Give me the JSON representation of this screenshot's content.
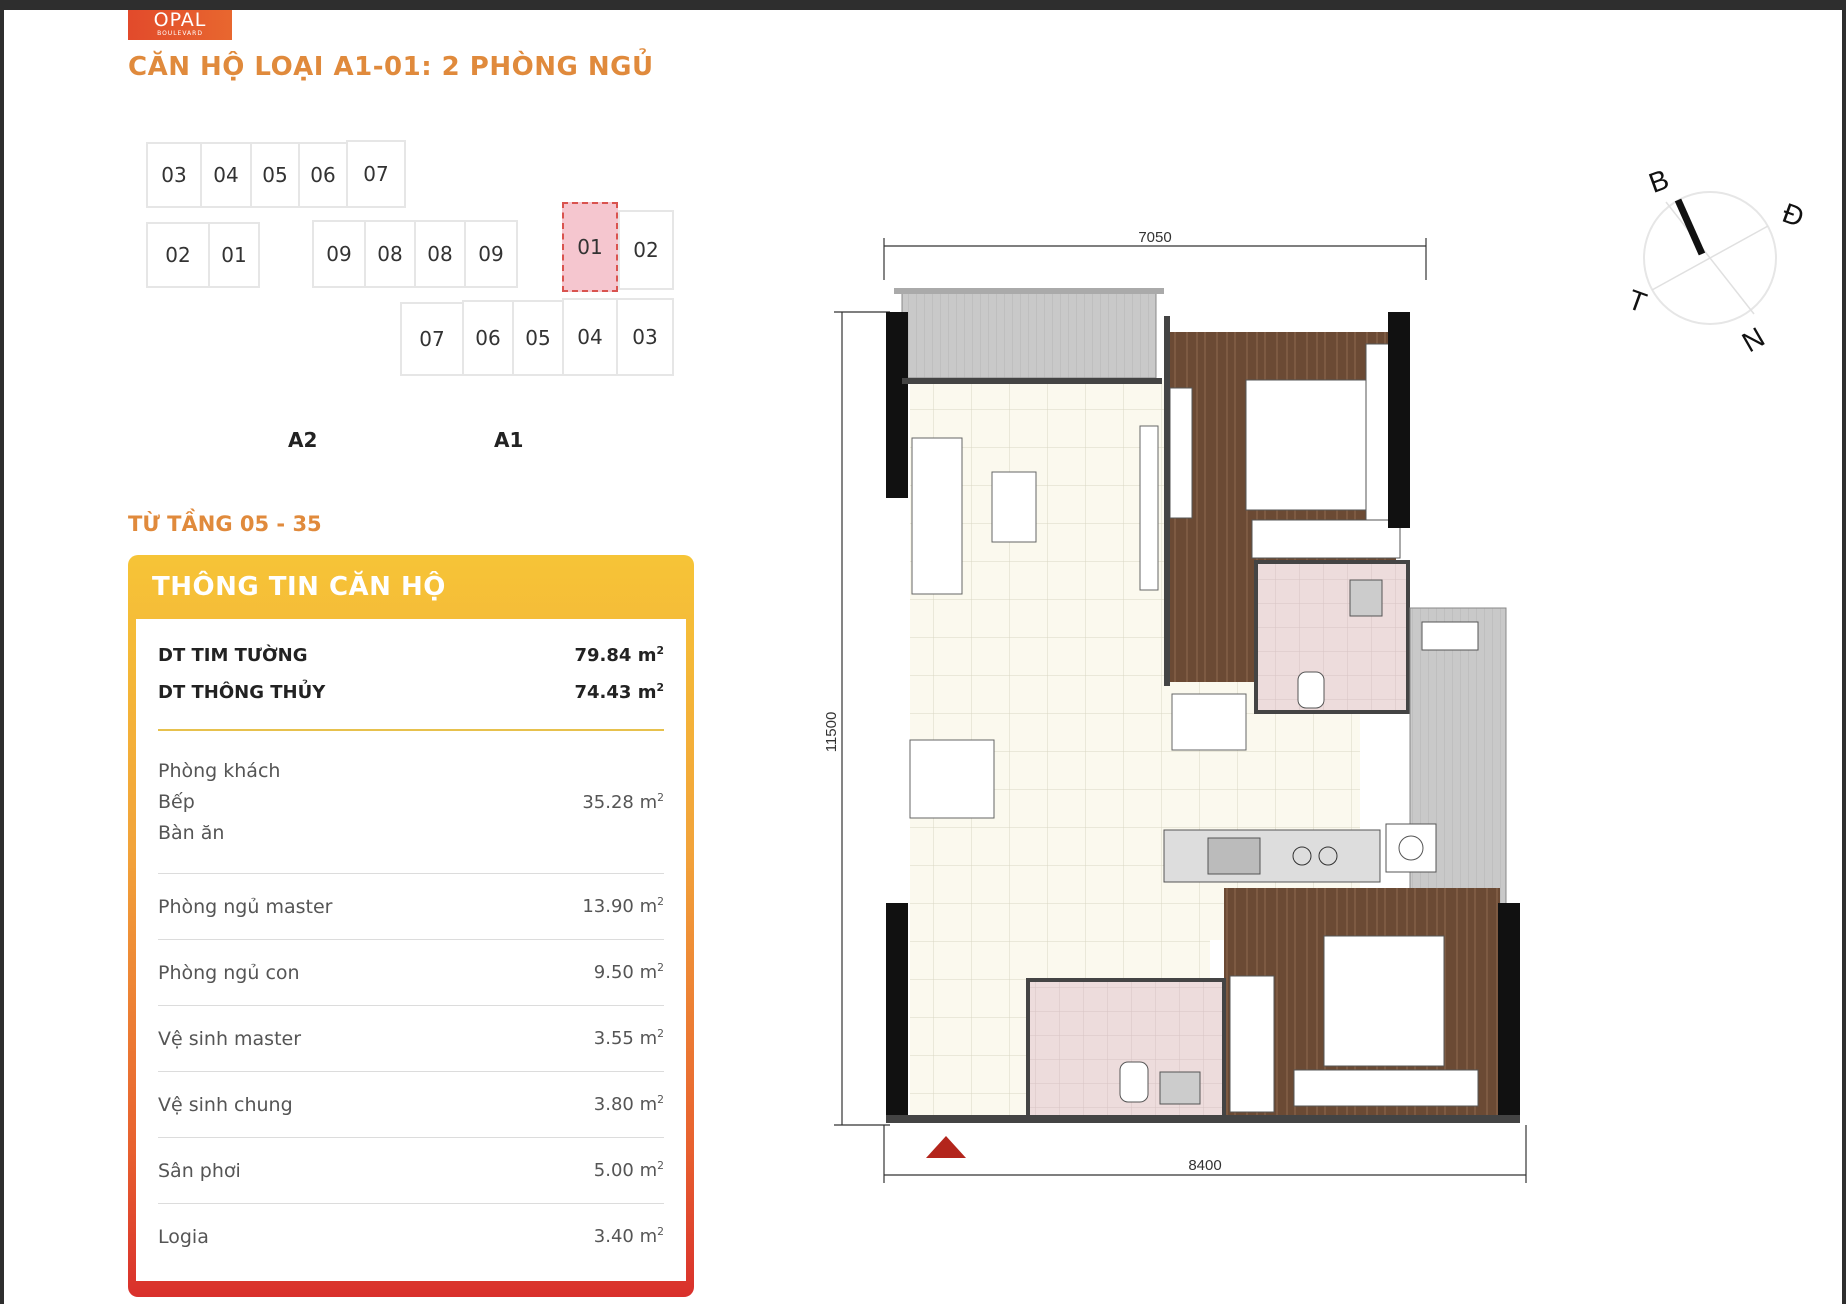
{
  "brand": {
    "logo_line1": "OPAL",
    "logo_line2": "BOULEVARD"
  },
  "title": "CĂN HỘ LOẠI A1-01: 2 PHÒNG NGỦ",
  "keyplan": {
    "row1": [
      "03",
      "04",
      "05",
      "06",
      "07"
    ],
    "row2_left": [
      "02",
      "01"
    ],
    "row2_mid": [
      "09",
      "08",
      "08",
      "09"
    ],
    "selected": "01",
    "row2_right": "02",
    "row3": [
      "07",
      "06",
      "05",
      "04",
      "03"
    ],
    "block_labels": [
      "A2",
      "A1"
    ]
  },
  "floors": "TỪ TẦNG 05 - 35",
  "info": {
    "header": "THÔNG TIN CĂN HỘ",
    "unit": "m",
    "exp": "2",
    "summary": [
      {
        "label": "DT TIM TƯỜNG",
        "value": "79.84"
      },
      {
        "label": "DT THÔNG THỦY",
        "value": "74.43"
      }
    ],
    "rooms_group": {
      "labels": [
        "Phòng khách",
        "Bếp",
        "Bàn ăn"
      ],
      "value": "35.28"
    },
    "rooms": [
      {
        "label": "Phòng ngủ master",
        "value": "13.90"
      },
      {
        "label": "Phòng ngủ con",
        "value": "9.50"
      },
      {
        "label": "Vệ sinh master",
        "value": "3.55"
      },
      {
        "label": "Vệ sinh chung",
        "value": "3.80"
      },
      {
        "label": "Sân phơi",
        "value": "5.00"
      },
      {
        "label": "Logia",
        "value": "3.40"
      }
    ]
  },
  "floorplan": {
    "dim_top": "7050",
    "dim_left": "11500",
    "dim_bottom": "8400"
  },
  "compass": {
    "north": "B",
    "east": "Đ",
    "west": "T",
    "south": "N"
  },
  "colors": {
    "accent_orange": "#e08a3c",
    "panel_top": "#f6c437",
    "panel_bottom": "#d9302c",
    "wood": "#6b4a34",
    "entry_marker": "#b3251c"
  }
}
